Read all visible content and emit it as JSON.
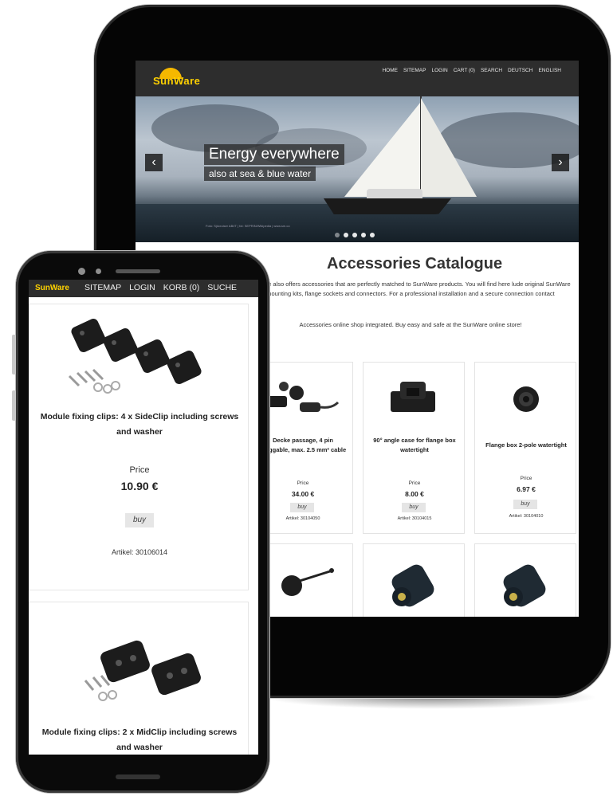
{
  "tablet": {
    "logo": "SunWare",
    "nav": [
      "HOME",
      "SITEMAP",
      "LOGIN",
      "CART (0)",
      "SEARCH",
      "DEUTSCH",
      "ENGLISH"
    ],
    "hero": {
      "title": "Energy everywhere",
      "subtitle": "also at sea & blue water",
      "prev": "‹",
      "next": "›",
      "credit": "Foto: Sjöcruiser AB/IT | fot: SEPRIN/Wikipedia | www.sm.co"
    },
    "catalogue": {
      "title": "Accessories Catalogue",
      "intro": "unWare also offers accessories that are perfectly matched to SunWare products. You will find here lude original SunWare mounting kits, flange sockets and connectors. For a professional installation and a secure connection contact",
      "shop": "Accessories online shop integrated. Buy easy and safe at the SunWare online store!"
    },
    "products": [
      {
        "name": "Decke passage, 4 pin pluggable, max. 2.5 mm² cable",
        "price_label": "Price",
        "price": "34.00 €",
        "buy": "buy",
        "article": "Artikel: 30104050"
      },
      {
        "name": "90° angle case for flange box watertight",
        "price_label": "Price",
        "price": "8.00 €",
        "buy": "buy",
        "article": "Artikel: 30104015"
      },
      {
        "name": "Flange box 2-pole watertight",
        "price_label": "Price",
        "price": "6.97 €",
        "buy": "buy",
        "article": "Artikel: 30104010"
      }
    ]
  },
  "phone": {
    "logo": "SunWare",
    "nav": [
      "SITEMAP",
      "LOGIN",
      "KORB (0)",
      "SUCHE"
    ],
    "products": [
      {
        "name": "Module fixing clips: 4 x SideClip including screws and washer",
        "price_label": "Price",
        "price": "10.90 €",
        "buy": "buy",
        "article": "Artikel: 30106014"
      },
      {
        "name": "Module fixing clips: 2 x MidClip including screws and washer"
      }
    ]
  }
}
